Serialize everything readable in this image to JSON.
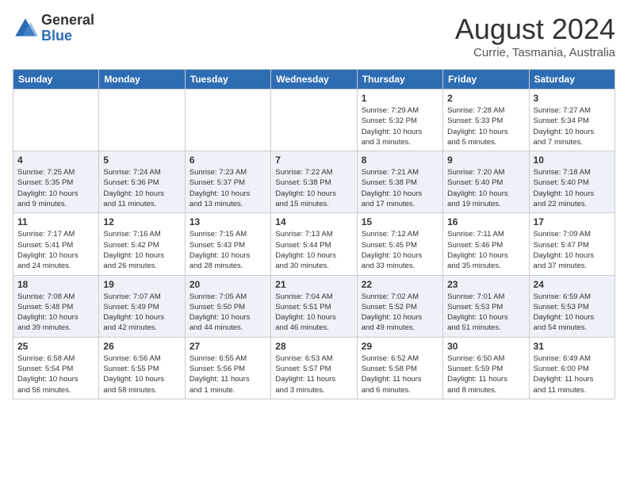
{
  "header": {
    "logo_general": "General",
    "logo_blue": "Blue",
    "month_year": "August 2024",
    "location": "Currie, Tasmania, Australia"
  },
  "weekdays": [
    "Sunday",
    "Monday",
    "Tuesday",
    "Wednesday",
    "Thursday",
    "Friday",
    "Saturday"
  ],
  "weeks": [
    [
      {
        "day": "",
        "info": ""
      },
      {
        "day": "",
        "info": ""
      },
      {
        "day": "",
        "info": ""
      },
      {
        "day": "",
        "info": ""
      },
      {
        "day": "1",
        "info": "Sunrise: 7:29 AM\nSunset: 5:32 PM\nDaylight: 10 hours\nand 3 minutes."
      },
      {
        "day": "2",
        "info": "Sunrise: 7:28 AM\nSunset: 5:33 PM\nDaylight: 10 hours\nand 5 minutes."
      },
      {
        "day": "3",
        "info": "Sunrise: 7:27 AM\nSunset: 5:34 PM\nDaylight: 10 hours\nand 7 minutes."
      }
    ],
    [
      {
        "day": "4",
        "info": "Sunrise: 7:25 AM\nSunset: 5:35 PM\nDaylight: 10 hours\nand 9 minutes."
      },
      {
        "day": "5",
        "info": "Sunrise: 7:24 AM\nSunset: 5:36 PM\nDaylight: 10 hours\nand 11 minutes."
      },
      {
        "day": "6",
        "info": "Sunrise: 7:23 AM\nSunset: 5:37 PM\nDaylight: 10 hours\nand 13 minutes."
      },
      {
        "day": "7",
        "info": "Sunrise: 7:22 AM\nSunset: 5:38 PM\nDaylight: 10 hours\nand 15 minutes."
      },
      {
        "day": "8",
        "info": "Sunrise: 7:21 AM\nSunset: 5:38 PM\nDaylight: 10 hours\nand 17 minutes."
      },
      {
        "day": "9",
        "info": "Sunrise: 7:20 AM\nSunset: 5:40 PM\nDaylight: 10 hours\nand 19 minutes."
      },
      {
        "day": "10",
        "info": "Sunrise: 7:18 AM\nSunset: 5:40 PM\nDaylight: 10 hours\nand 22 minutes."
      }
    ],
    [
      {
        "day": "11",
        "info": "Sunrise: 7:17 AM\nSunset: 5:41 PM\nDaylight: 10 hours\nand 24 minutes."
      },
      {
        "day": "12",
        "info": "Sunrise: 7:16 AM\nSunset: 5:42 PM\nDaylight: 10 hours\nand 26 minutes."
      },
      {
        "day": "13",
        "info": "Sunrise: 7:15 AM\nSunset: 5:43 PM\nDaylight: 10 hours\nand 28 minutes."
      },
      {
        "day": "14",
        "info": "Sunrise: 7:13 AM\nSunset: 5:44 PM\nDaylight: 10 hours\nand 30 minutes."
      },
      {
        "day": "15",
        "info": "Sunrise: 7:12 AM\nSunset: 5:45 PM\nDaylight: 10 hours\nand 33 minutes."
      },
      {
        "day": "16",
        "info": "Sunrise: 7:11 AM\nSunset: 5:46 PM\nDaylight: 10 hours\nand 35 minutes."
      },
      {
        "day": "17",
        "info": "Sunrise: 7:09 AM\nSunset: 5:47 PM\nDaylight: 10 hours\nand 37 minutes."
      }
    ],
    [
      {
        "day": "18",
        "info": "Sunrise: 7:08 AM\nSunset: 5:48 PM\nDaylight: 10 hours\nand 39 minutes."
      },
      {
        "day": "19",
        "info": "Sunrise: 7:07 AM\nSunset: 5:49 PM\nDaylight: 10 hours\nand 42 minutes."
      },
      {
        "day": "20",
        "info": "Sunrise: 7:05 AM\nSunset: 5:50 PM\nDaylight: 10 hours\nand 44 minutes."
      },
      {
        "day": "21",
        "info": "Sunrise: 7:04 AM\nSunset: 5:51 PM\nDaylight: 10 hours\nand 46 minutes."
      },
      {
        "day": "22",
        "info": "Sunrise: 7:02 AM\nSunset: 5:52 PM\nDaylight: 10 hours\nand 49 minutes."
      },
      {
        "day": "23",
        "info": "Sunrise: 7:01 AM\nSunset: 5:53 PM\nDaylight: 10 hours\nand 51 minutes."
      },
      {
        "day": "24",
        "info": "Sunrise: 6:59 AM\nSunset: 5:53 PM\nDaylight: 10 hours\nand 54 minutes."
      }
    ],
    [
      {
        "day": "25",
        "info": "Sunrise: 6:58 AM\nSunset: 5:54 PM\nDaylight: 10 hours\nand 56 minutes."
      },
      {
        "day": "26",
        "info": "Sunrise: 6:56 AM\nSunset: 5:55 PM\nDaylight: 10 hours\nand 58 minutes."
      },
      {
        "day": "27",
        "info": "Sunrise: 6:55 AM\nSunset: 5:56 PM\nDaylight: 11 hours\nand 1 minute."
      },
      {
        "day": "28",
        "info": "Sunrise: 6:53 AM\nSunset: 5:57 PM\nDaylight: 11 hours\nand 3 minutes."
      },
      {
        "day": "29",
        "info": "Sunrise: 6:52 AM\nSunset: 5:58 PM\nDaylight: 11 hours\nand 6 minutes."
      },
      {
        "day": "30",
        "info": "Sunrise: 6:50 AM\nSunset: 5:59 PM\nDaylight: 11 hours\nand 8 minutes."
      },
      {
        "day": "31",
        "info": "Sunrise: 6:49 AM\nSunset: 6:00 PM\nDaylight: 11 hours\nand 11 minutes."
      }
    ]
  ]
}
